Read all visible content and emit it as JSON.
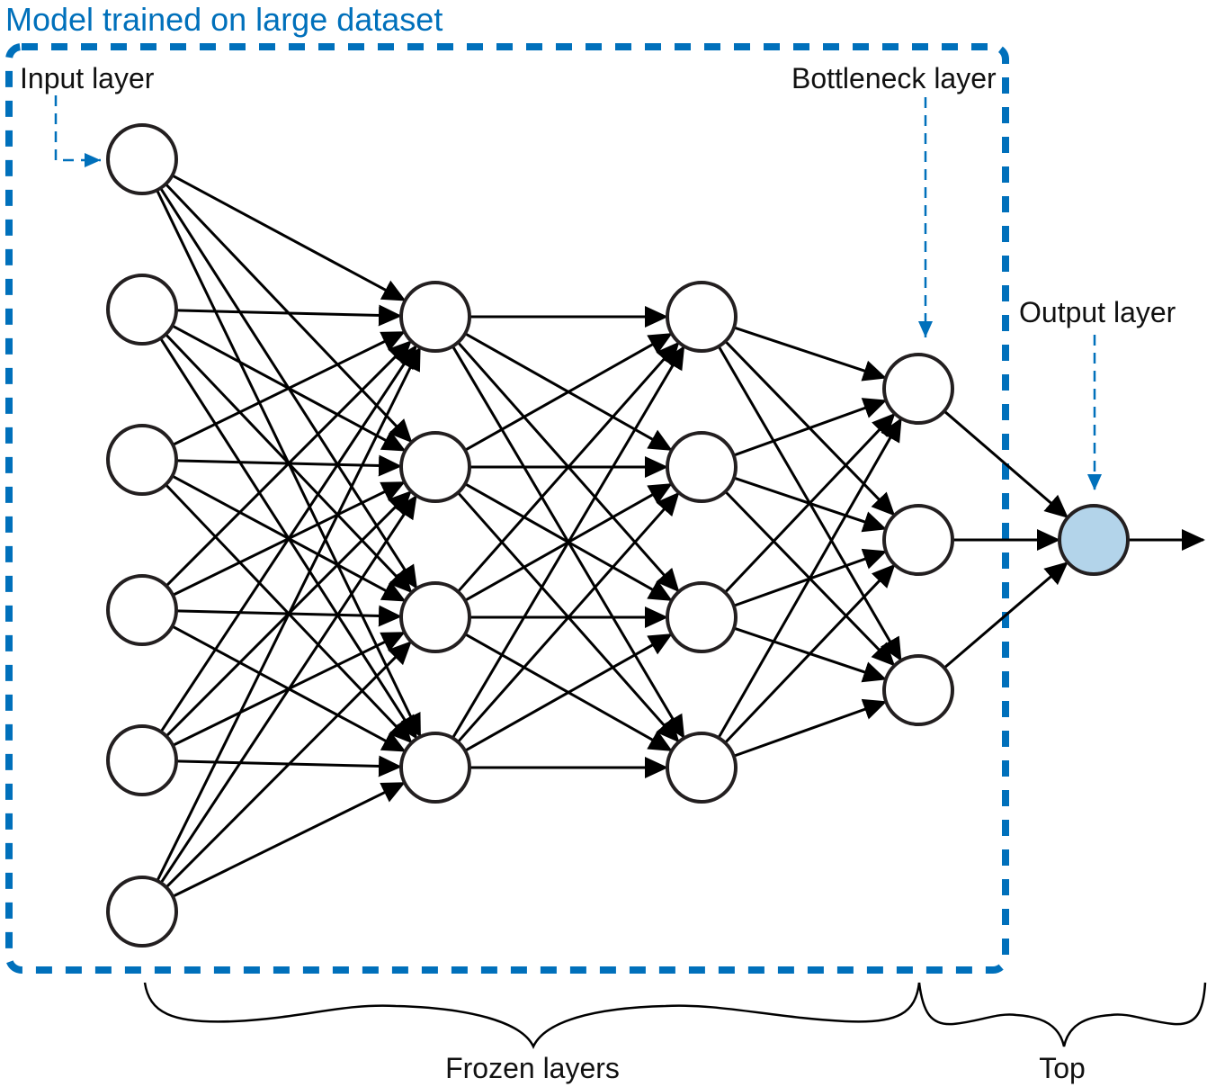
{
  "title": "Model trained on large dataset",
  "labels": {
    "input_layer": "Input layer",
    "bottleneck_layer": "Bottleneck layer",
    "output_layer": "Output layer",
    "frozen_layers": "Frozen layers",
    "top": "Top"
  },
  "colors": {
    "accent_blue": "#0070BB",
    "output_node_fill": "#B3D4EA",
    "node_stroke": "#231F20",
    "edge": "#000000"
  },
  "network": {
    "layers": [
      {
        "name": "input",
        "nodes": 6,
        "group": "frozen"
      },
      {
        "name": "hidden-1",
        "nodes": 4,
        "group": "frozen"
      },
      {
        "name": "hidden-2",
        "nodes": 4,
        "group": "frozen"
      },
      {
        "name": "bottleneck",
        "nodes": 3,
        "group": "frozen"
      },
      {
        "name": "output",
        "nodes": 1,
        "group": "top"
      }
    ],
    "connectivity": "fully-connected",
    "output_arrow": true
  }
}
